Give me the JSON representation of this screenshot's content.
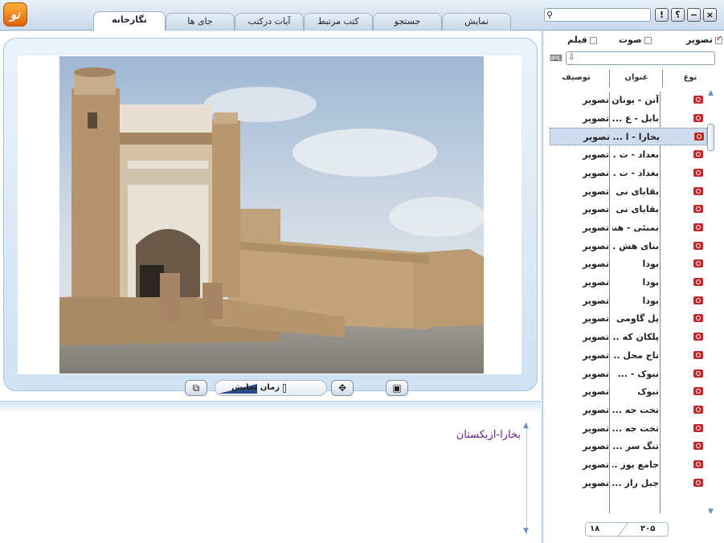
{
  "app": {
    "logo_text": "نو"
  },
  "tabs": [
    {
      "label": "نگارخانه",
      "active": true
    },
    {
      "label": "جای ها",
      "active": false
    },
    {
      "label": "آیات درکتب",
      "active": false
    },
    {
      "label": "کتب مرتبط",
      "active": false
    },
    {
      "label": "جستجو",
      "active": false
    },
    {
      "label": "نمایش",
      "active": false
    }
  ],
  "window": {
    "search_placeholder": "",
    "help": "؟",
    "info": "!",
    "minimize": "−",
    "close": "×"
  },
  "viewer": {
    "slider_label": "زمان نمایش",
    "description": "بخارا-ازبکستان"
  },
  "filters": [
    {
      "label": "تصویر",
      "checked": true
    },
    {
      "label": "صوت",
      "checked": false
    },
    {
      "label": "فیلم",
      "checked": false
    }
  ],
  "list": {
    "search_value": "",
    "columns": {
      "type": "نوع",
      "title": "عنوان",
      "desc": "توصیف"
    },
    "rows": [
      {
        "title": "آتن - یونان",
        "type": "تصویر"
      },
      {
        "title": "بابل - ع ...",
        "type": "تصویر"
      },
      {
        "title": "بخارا - ا ...",
        "type": "تصویر",
        "selected": true
      },
      {
        "title": "بغداد - ت ...",
        "type": "تصویر"
      },
      {
        "title": "بغداد - ت ...",
        "type": "تصویر"
      },
      {
        "title": "بقایای نی ...",
        "type": "تصویر"
      },
      {
        "title": "بقایای نی ...",
        "type": "تصویر"
      },
      {
        "title": "بمبئی - هند",
        "type": "تصویر"
      },
      {
        "title": "بنای هش ...",
        "type": "تصویر"
      },
      {
        "title": "بودا",
        "type": "تصویر"
      },
      {
        "title": "بودا",
        "type": "تصویر"
      },
      {
        "title": "بودا",
        "type": "تصویر"
      },
      {
        "title": "پل گاومی ...",
        "type": "تصویر"
      },
      {
        "title": "پلکان که ...",
        "type": "تصویر"
      },
      {
        "title": "تاج محل ...",
        "type": "تصویر"
      },
      {
        "title": "تبوک - ...",
        "type": "تصویر"
      },
      {
        "title": "تبوک",
        "type": "تصویر"
      },
      {
        "title": "تخت جه ...",
        "type": "تصویر"
      },
      {
        "title": "تخت جه ...",
        "type": "تصویر"
      },
      {
        "title": "تنگ سر ...",
        "type": "تصویر"
      },
      {
        "title": "جامع یوز ...",
        "type": "تصویر"
      },
      {
        "title": "جبل راز ...",
        "type": "تصویر"
      }
    ],
    "pager": {
      "current": "۱۸",
      "total": "۳۰۵"
    }
  }
}
